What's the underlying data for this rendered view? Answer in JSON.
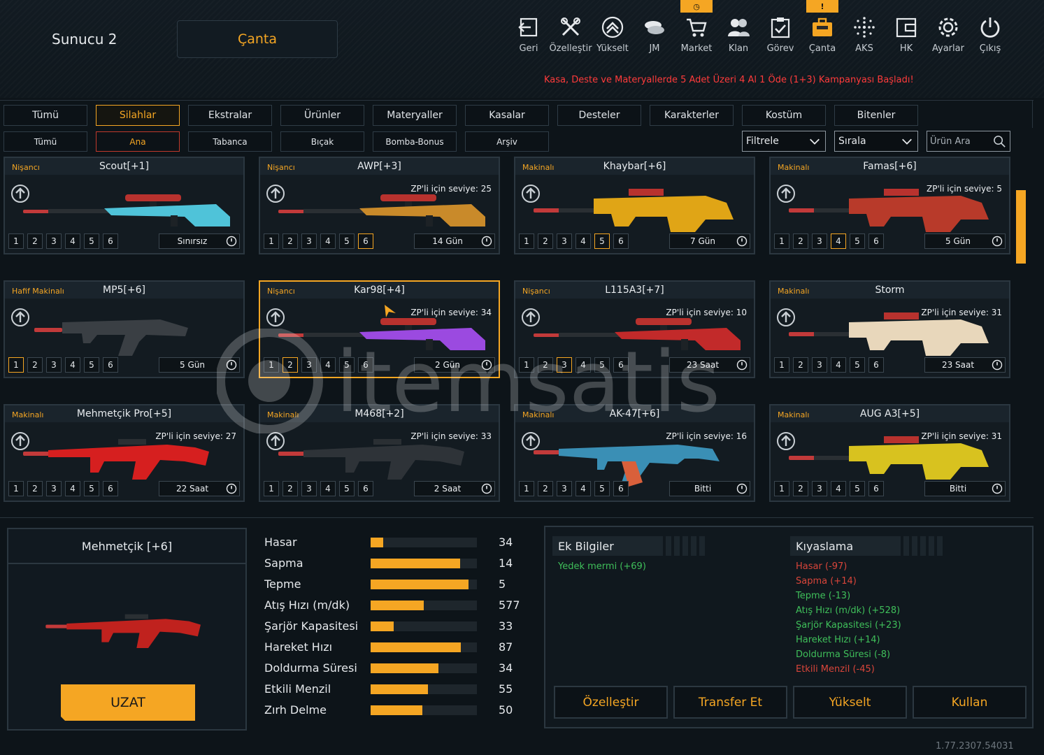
{
  "header": {
    "server": "Sunucu 2",
    "page_title": "Çanta",
    "campaign": "Kasa, Deste ve Materyallerde 5 Adet Üzeri 4 Al 1 Öde (1+3) Kampanyası Başladı!"
  },
  "nav": [
    {
      "label": "Geri",
      "icon": "back-icon"
    },
    {
      "label": "Özelleştir",
      "icon": "tools-icon"
    },
    {
      "label": "Yükselt",
      "icon": "upgrade-icon"
    },
    {
      "label": "JM",
      "icon": "coins-icon"
    },
    {
      "label": "Market",
      "icon": "cart-icon",
      "badge": "clock"
    },
    {
      "label": "Klan",
      "icon": "clan-icon"
    },
    {
      "label": "Görev",
      "icon": "mission-icon"
    },
    {
      "label": "Çanta",
      "icon": "bag-icon",
      "badge": "!",
      "active": true
    },
    {
      "label": "AKS",
      "icon": "aks-icon"
    },
    {
      "label": "HK",
      "icon": "wallet-icon"
    },
    {
      "label": "Ayarlar",
      "icon": "gear-icon"
    },
    {
      "label": "Çıkış",
      "icon": "power-icon"
    }
  ],
  "tabs_main": [
    "Tümü",
    "Silahlar",
    "Ekstralar",
    "Ürünler",
    "Materyaller",
    "Kasalar",
    "Desteler",
    "Karakterler",
    "Kostüm",
    "Bitenler"
  ],
  "tabs_main_active": 1,
  "tabs_sub": [
    "Tümü",
    "Ana",
    "Tabanca",
    "Bıçak",
    "Bomba-Bonus",
    "Arşiv"
  ],
  "tabs_sub_active": 1,
  "filter": {
    "label": "Filtrele",
    "sort": "Sırala",
    "search_placeholder": "Ürün Ara"
  },
  "weapons": [
    {
      "category": "Nişancı",
      "name": "Scout[+1]",
      "zp": "",
      "slots": 6,
      "active_slot": 0,
      "duration": "Sınırsız",
      "color": "#4fc3d9",
      "type": "sniper"
    },
    {
      "category": "Nişancı",
      "name": "AWP[+3]",
      "zp": "ZP'li için seviye: 25",
      "slots": 6,
      "active_slot": 6,
      "duration": "14 Gün",
      "color": "#c98a2a",
      "type": "sniper"
    },
    {
      "category": "Makinalı",
      "name": "Khaybar[+6]",
      "zp": "",
      "slots": 6,
      "active_slot": 5,
      "duration": "7 Gün",
      "color": "#e0a516",
      "type": "bullpup"
    },
    {
      "category": "Makinalı",
      "name": "Famas[+6]",
      "zp": "ZP'li için seviye: 5",
      "slots": 6,
      "active_slot": 4,
      "duration": "5 Gün",
      "color": "#b83a2a",
      "type": "bullpup"
    },
    {
      "category": "Hafif Makinalı",
      "name": "MP5[+6]",
      "zp": "",
      "slots": 6,
      "active_slot": 1,
      "duration": "5 Gün",
      "color": "#3a3f44",
      "type": "smg"
    },
    {
      "category": "Nişancı",
      "name": "Kar98[+4]",
      "zp": "ZP'li için seviye: 34",
      "slots": 6,
      "active_slot": 2,
      "duration": "2 Gün",
      "color": "#9b4ae0",
      "type": "sniper"
    },
    {
      "category": "Nişancı",
      "name": "L115A3[+7]",
      "zp": "ZP'li için seviye: 10",
      "slots": 6,
      "active_slot": 3,
      "duration": "23 Saat",
      "color": "#c22a2a",
      "type": "sniper"
    },
    {
      "category": "Makinalı",
      "name": "Storm",
      "zp": "ZP'li için seviye: 31",
      "slots": 6,
      "active_slot": 0,
      "duration": "23 Saat",
      "color": "#e8d7bb",
      "type": "bullpup"
    },
    {
      "category": "Makinalı",
      "name": "Mehmetçik Pro[+5]",
      "zp": "ZP'li için seviye: 27",
      "slots": 6,
      "active_slot": 0,
      "duration": "22 Saat",
      "color": "#d61f1f",
      "type": "rifle"
    },
    {
      "category": "Makinalı",
      "name": "M468[+2]",
      "zp": "ZP'li için seviye: 33",
      "slots": 6,
      "active_slot": 0,
      "duration": "2 Saat",
      "color": "#2e3338",
      "type": "rifle"
    },
    {
      "category": "Makinalı",
      "name": "AK-47[+6]",
      "zp": "ZP'li için seviye: 16",
      "slots": 6,
      "active_slot": 0,
      "duration": "Bitti",
      "color": "#3a8fb5",
      "type": "ak"
    },
    {
      "category": "Makinalı",
      "name": "AUG A3[+5]",
      "zp": "ZP'li için seviye: 31",
      "slots": 6,
      "active_slot": 0,
      "duration": "Bitti",
      "color": "#d8c21f",
      "type": "bullpup"
    }
  ],
  "selected_card": 5,
  "detail": {
    "name": "Mehmetçik [+6]",
    "extend_button": "UZAT",
    "gun_color": "#c0221e"
  },
  "stats": [
    {
      "label": "Hasar",
      "value": "34",
      "fill": 0.12
    },
    {
      "label": "Sapma",
      "value": "14",
      "fill": 0.84
    },
    {
      "label": "Tepme",
      "value": "5",
      "fill": 0.92
    },
    {
      "label": "Atış Hızı (m/dk)",
      "value": "577",
      "fill": 0.5
    },
    {
      "label": "Şarjör Kapasitesi",
      "value": "33",
      "fill": 0.22
    },
    {
      "label": "Hareket Hızı",
      "value": "87",
      "fill": 0.85
    },
    {
      "label": "Doldurma Süresi",
      "value": "34",
      "fill": 0.64
    },
    {
      "label": "Etkili Menzil",
      "value": "55",
      "fill": 0.54
    },
    {
      "label": "Zırh Delme",
      "value": "50",
      "fill": 0.49
    }
  ],
  "extra_info": {
    "title": "Ek Bilgiler",
    "lines": [
      "Yedek mermi (+69)"
    ]
  },
  "compare": {
    "title": "Kıyaslama",
    "lines": [
      {
        "text": "Hasar (-97)",
        "tone": "neg"
      },
      {
        "text": "Sapma (+14)",
        "tone": "neg"
      },
      {
        "text": "Tepme (-13)",
        "tone": "pos"
      },
      {
        "text": "Atış Hızı (m/dk) (+528)",
        "tone": "pos"
      },
      {
        "text": "Şarjör Kapasitesi (+23)",
        "tone": "pos"
      },
      {
        "text": "Hareket Hızı (+14)",
        "tone": "pos"
      },
      {
        "text": "Doldurma Süresi (-8)",
        "tone": "pos"
      },
      {
        "text": "Etkili Menzil (-45)",
        "tone": "neg"
      }
    ]
  },
  "actions": [
    "Özelleştir",
    "Transfer Et",
    "Yükselt",
    "Kullan"
  ],
  "version": "1.77.2307.54031"
}
